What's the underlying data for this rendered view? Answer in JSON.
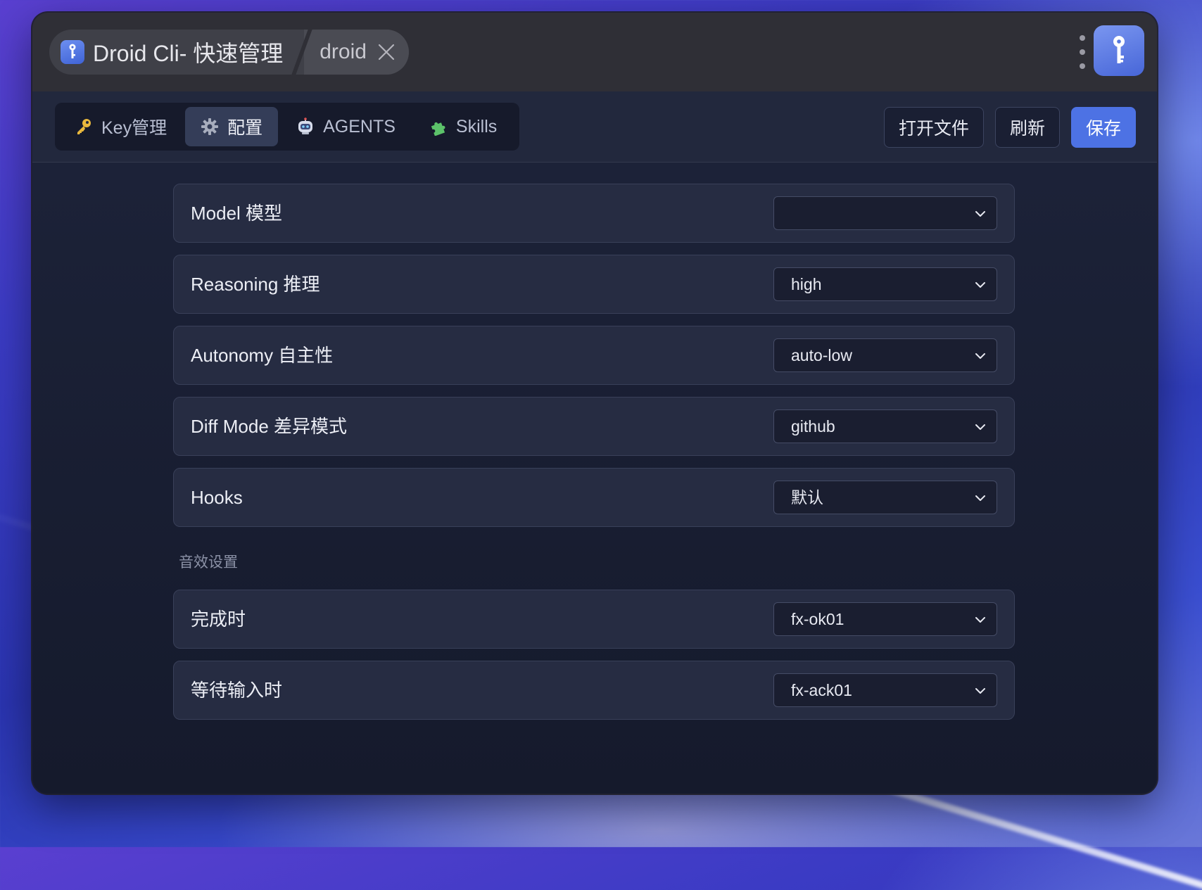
{
  "window": {
    "title": "Droid Cli- 快速管理",
    "profile_tab": "droid"
  },
  "tabs": [
    {
      "label": "Key管理",
      "icon": "key-icon",
      "active": false
    },
    {
      "label": "配置",
      "icon": "gear-icon",
      "active": true
    },
    {
      "label": "AGENTS",
      "icon": "robot-icon",
      "active": false
    },
    {
      "label": "Skills",
      "icon": "puzzle-icon",
      "active": false
    }
  ],
  "actions": {
    "open_file": "打开文件",
    "refresh": "刷新",
    "save": "保存"
  },
  "settings": [
    {
      "label": "Model 模型",
      "value": ""
    },
    {
      "label": "Reasoning 推理",
      "value": "high"
    },
    {
      "label": "Autonomy 自主性",
      "value": "auto-low"
    },
    {
      "label": "Diff Mode 差异模式",
      "value": "github"
    },
    {
      "label": "Hooks",
      "value": "默认"
    }
  ],
  "sound_section": {
    "title": "音效设置",
    "items": [
      {
        "label": "完成时",
        "value": "fx-ok01"
      },
      {
        "label": "等待输入时",
        "value": "fx-ack01"
      }
    ]
  },
  "colors": {
    "accent": "#4d72e4",
    "window_bg": "#181c30",
    "row_bg": "#262c42"
  }
}
